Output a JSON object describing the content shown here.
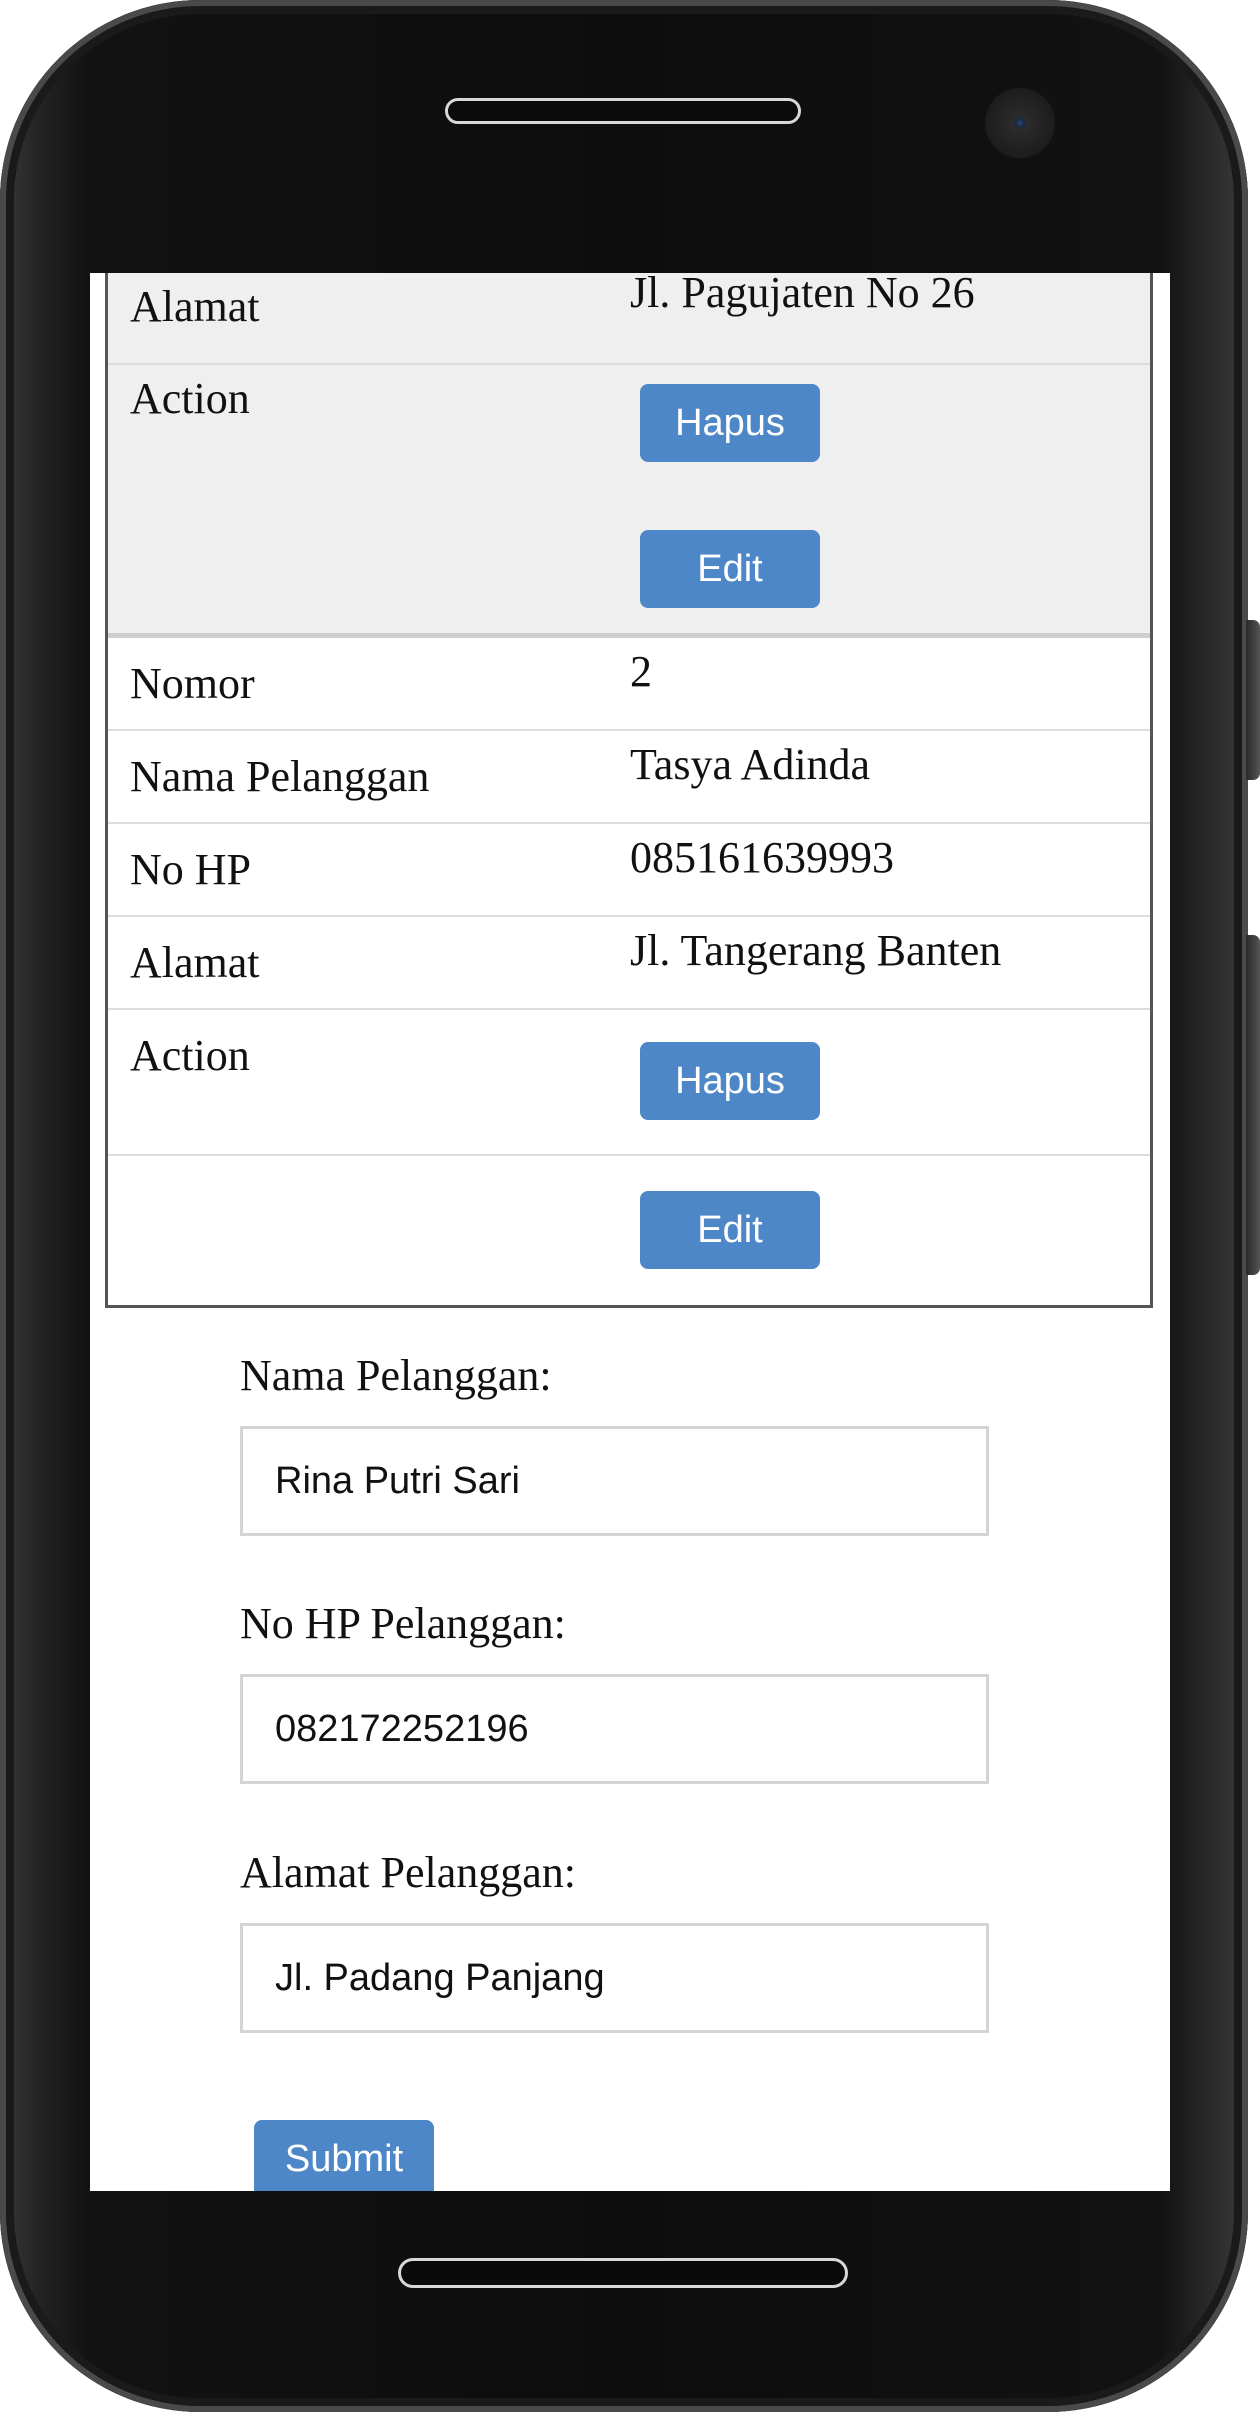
{
  "records": [
    {
      "fields": [
        {
          "label": "Alamat",
          "value": "Jl. Pagujaten No 26"
        },
        {
          "label": "Action",
          "value": ""
        }
      ],
      "delete_label": "Hapus",
      "edit_label": "Edit"
    },
    {
      "fields": [
        {
          "label": "Nomor",
          "value": "2"
        },
        {
          "label": "Nama Pelanggan",
          "value": "Tasya Adinda"
        },
        {
          "label": "No HP",
          "value": "085161639993"
        },
        {
          "label": "Alamat",
          "value": "Jl. Tangerang Banten"
        },
        {
          "label": "Action",
          "value": ""
        }
      ],
      "delete_label": "Hapus",
      "edit_label": "Edit"
    }
  ],
  "form": {
    "name_label": "Nama Pelanggan:",
    "name_value": "Rina Putri Sari",
    "phone_label": "No HP Pelanggan:",
    "phone_value": "082172252196",
    "address_label": "Alamat Pelanggan:",
    "address_value": "Jl. Padang Panjang",
    "submit_label": "Submit"
  },
  "colors": {
    "button": "#4e87c7",
    "shaded_row": "#efefef",
    "device_body": "#0d0d0d"
  }
}
